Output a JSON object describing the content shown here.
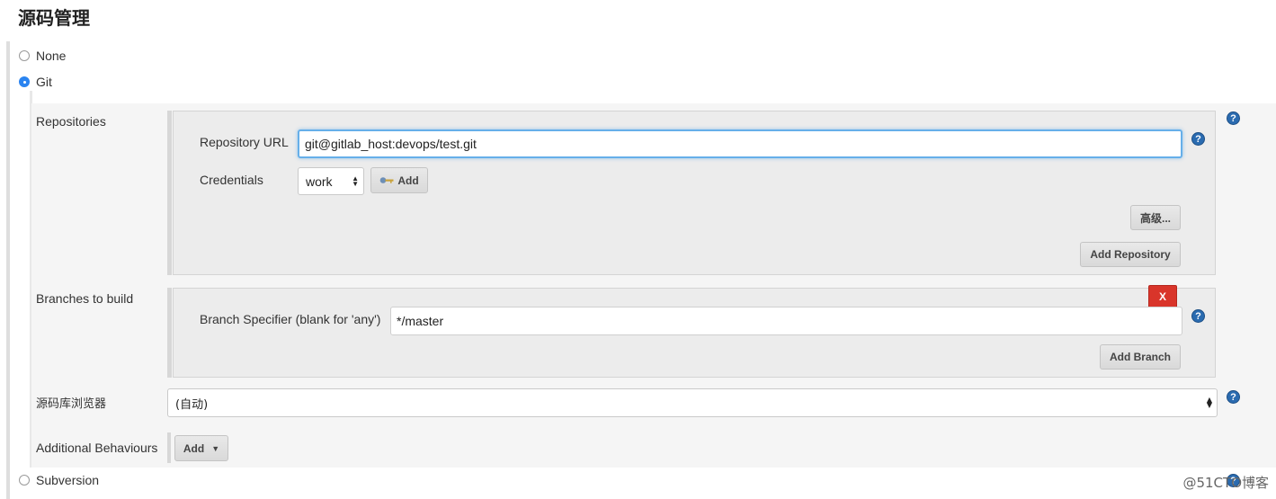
{
  "page_title": "源码管理",
  "scm_options": {
    "none_label": "None",
    "git_label": "Git",
    "subversion_label": "Subversion",
    "selected": "Git"
  },
  "repositories": {
    "label": "Repositories",
    "repository_url_label": "Repository URL",
    "repository_url_value": "git@gitlab_host:devops/test.git",
    "credentials_label": "Credentials",
    "credentials_selected": "work",
    "add_credentials_button": "Add",
    "advanced_button": "高级...",
    "add_repository_button": "Add Repository"
  },
  "branches": {
    "label": "Branches to build",
    "delete_button": "X",
    "branch_specifier_label": "Branch Specifier (blank for 'any')",
    "branch_specifier_value": "*/master",
    "add_branch_button": "Add Branch"
  },
  "repo_browser": {
    "label": "源码库浏览器",
    "selected": "(自动)"
  },
  "additional_behaviours": {
    "label": "Additional Behaviours",
    "add_button": "Add"
  },
  "help_icon_text": "?",
  "watermark": "@51CTO博客",
  "colors": {
    "radio_selected": "#2b84f0",
    "help_icon": "#2a6bb0",
    "delete_button": "#d9352a",
    "input_focus": "#66afe9"
  }
}
